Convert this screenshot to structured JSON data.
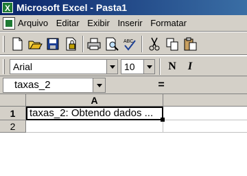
{
  "window": {
    "title": "Microsoft Excel - Pasta1"
  },
  "menubar": {
    "items": [
      {
        "label": "Arquivo"
      },
      {
        "label": "Editar"
      },
      {
        "label": "Exibir"
      },
      {
        "label": "Inserir"
      },
      {
        "label": "Formatar"
      }
    ]
  },
  "toolbar": {
    "buttons": [
      "new-icon",
      "open-icon",
      "save-icon",
      "permission-icon",
      "print-icon",
      "print-preview-icon",
      "spelling-icon",
      "cut-icon",
      "copy-icon"
    ]
  },
  "format_bar": {
    "font": "Arial",
    "size": "10",
    "bold_label": "N",
    "italic_label": "I"
  },
  "formula_bar": {
    "name_box": "taxas_2",
    "equals_label": "="
  },
  "sheet": {
    "columns": [
      "A"
    ],
    "rows": [
      "1",
      "2"
    ],
    "cells": {
      "A1": "taxas_2: Obtendo dados ..."
    }
  },
  "colors": {
    "title_bar": "#0a246a",
    "chrome": "#d4d0c8"
  }
}
